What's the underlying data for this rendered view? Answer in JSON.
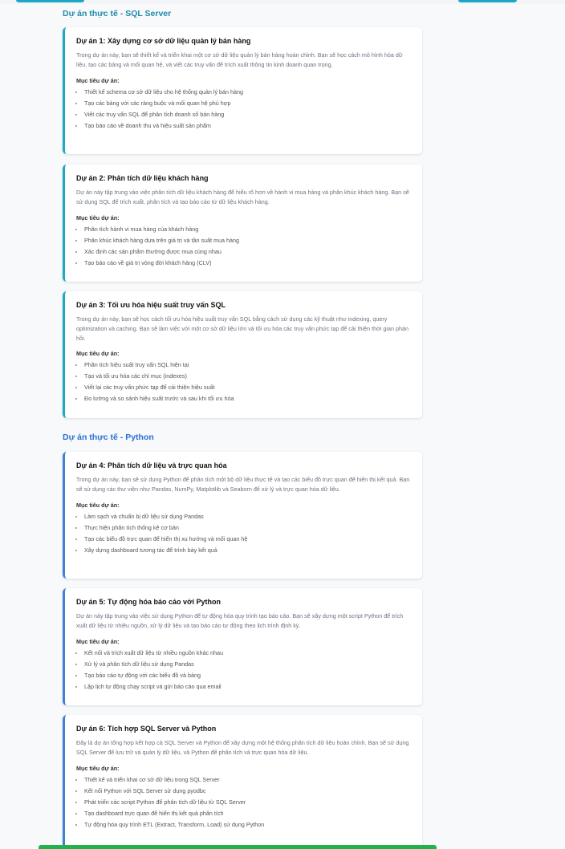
{
  "sections": [
    {
      "title": "Dự án thực tế - SQL Server",
      "projects": [
        {
          "title": "Dự án 1: Xây dựng cơ sở dữ liệu quản lý bán hàng",
          "description": "Trong dự án này, bạn sẽ thiết kế và triển khai một cơ sở dữ liệu quản lý bán hàng hoàn chỉnh. Bạn sẽ học cách mô hình hóa dữ liệu, tạo các bảng và mối quan hệ, và viết các truy vấn để trích xuất thông tin kinh doanh quan trọng.",
          "goals_label": "Mục tiêu dự án:",
          "goals": [
            "Thiết kế schema cơ sở dữ liệu cho hệ thống quản lý bán hàng",
            "Tạo các bảng với các ràng buộc và mối quan hệ phù hợp",
            "Viết các truy vấn SQL để phân tích doanh số bán hàng",
            "Tạo báo cáo về doanh thu và hiệu suất sản phẩm"
          ]
        },
        {
          "title": "Dự án 2: Phân tích dữ liệu khách hàng",
          "description": "Dự án này tập trung vào việc phân tích dữ liệu khách hàng để hiểu rõ hơn về hành vi mua hàng và phân khúc khách hàng. Bạn sẽ sử dụng SQL để trích xuất, phân tích và tạo báo cáo từ dữ liệu khách hàng.",
          "goals_label": "Mục tiêu dự án:",
          "goals": [
            "Phân tích hành vi mua hàng của khách hàng",
            "Phân khúc khách hàng dựa trên giá trị và tần suất mua hàng",
            "Xác định các sản phẩm thường được mua cùng nhau",
            "Tạo báo cáo về giá trị vòng đời khách hàng (CLV)"
          ]
        },
        {
          "title": "Dự án 3: Tối ưu hóa hiệu suất truy vấn SQL",
          "description": "Trong dự án này, bạn sẽ học cách tối ưu hóa hiệu suất truy vấn SQL bằng cách sử dụng các kỹ thuật như indexing, query optimization và caching. Bạn sẽ làm việc với một cơ sở dữ liệu lớn và tối ưu hóa các truy vấn phức tạp để cải thiện thời gian phản hồi.",
          "goals_label": "Mục tiêu dự án:",
          "goals": [
            "Phân tích hiệu suất truy vấn SQL hiện tại",
            "Tạo và tối ưu hóa các chỉ mục (indexes)",
            "Viết lại các truy vấn phức tạp để cải thiện hiệu suất",
            "Đo lường và so sánh hiệu suất trước và sau khi tối ưu hóa"
          ]
        }
      ]
    },
    {
      "title": "Dự án thực tế - Python",
      "projects": [
        {
          "title": "Dự án 4: Phân tích dữ liệu và trực quan hóa",
          "description": "Trong dự án này, bạn sẽ sử dụng Python để phân tích một bộ dữ liệu thực tế và tạo các biểu đồ trực quan để hiển thị kết quả. Bạn sẽ sử dụng các thư viện như Pandas, NumPy, Matplotlib và Seaborn để xử lý và trực quan hóa dữ liệu.",
          "goals_label": "Mục tiêu dự án:",
          "goals": [
            "Làm sạch và chuẩn bị dữ liệu sử dụng Pandas",
            "Thực hiện phân tích thống kê cơ bản",
            "Tạo các biểu đồ trực quan để hiển thị xu hướng và mối quan hệ",
            "Xây dựng dashboard tương tác để trình bày kết quả"
          ]
        },
        {
          "title": "Dự án 5: Tự động hóa báo cáo với Python",
          "description": "Dự án này tập trung vào việc sử dụng Python để tự động hóa quy trình tạo báo cáo. Bạn sẽ xây dựng một script Python để trích xuất dữ liệu từ nhiều nguồn, xử lý dữ liệu và tạo báo cáo tự động theo lịch trình định kỳ.",
          "goals_label": "Mục tiêu dự án:",
          "goals": [
            "Kết nối và trích xuất dữ liệu từ nhiều nguồn khác nhau",
            "Xử lý và phân tích dữ liệu sử dụng Pandas",
            "Tạo báo cáo tự động với các biểu đồ và bảng",
            "Lập lịch tự động chạy script và gửi báo cáo qua email"
          ]
        },
        {
          "title": "Dự án 6: Tích hợp SQL Server và Python",
          "description": "Đây là dự án tổng hợp kết hợp cả SQL Server và Python để xây dựng một hệ thống phân tích dữ liệu hoàn chỉnh. Bạn sẽ sử dụng SQL Server để lưu trữ và quản lý dữ liệu, và Python để phân tích và trực quan hóa dữ liệu.",
          "goals_label": "Mục tiêu dự án:",
          "goals": [
            "Thiết kế và triển khai cơ sở dữ liệu trong SQL Server",
            "Kết nối Python với SQL Server sử dụng pyodbc",
            "Phát triển các script Python để phân tích dữ liệu từ SQL Server",
            "Tạo dashboard trực quan để hiển thị kết quả phân tích",
            "Tự động hóa quy trình ETL (Extract, Transform, Load) sử dụng Python"
          ]
        }
      ]
    }
  ]
}
